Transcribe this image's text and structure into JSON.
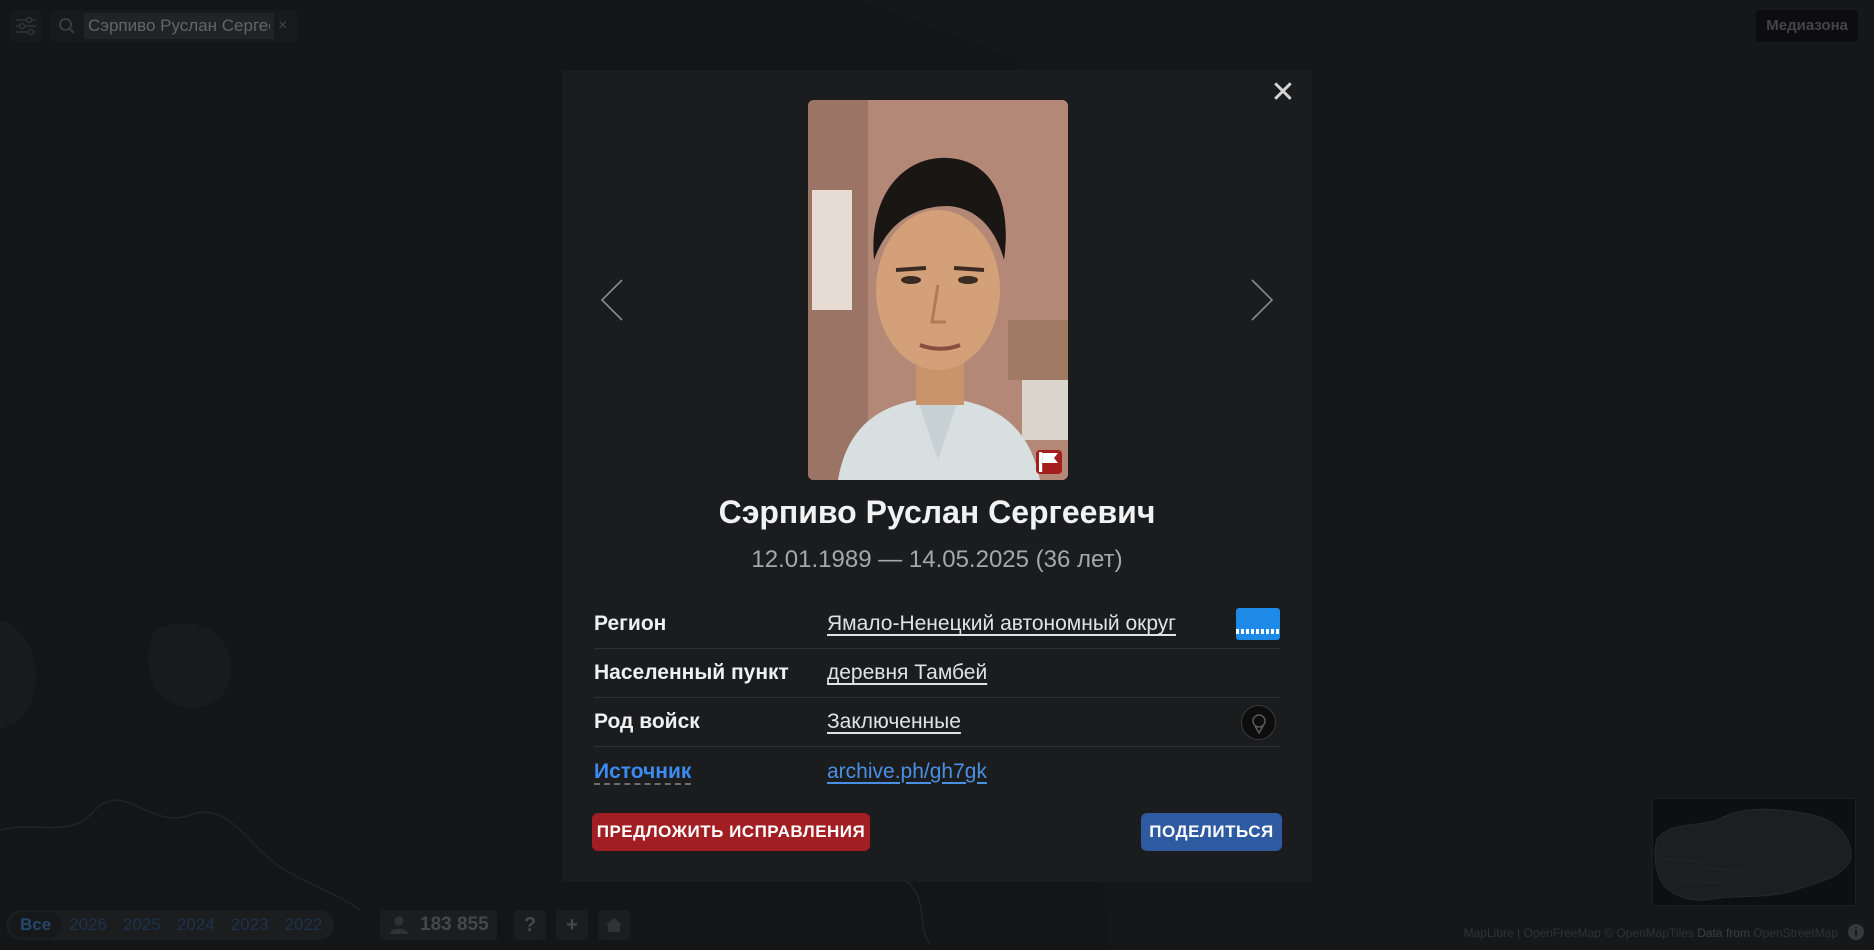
{
  "search": {
    "value": "Сэрпиво Руслан Сергее",
    "clear_symbol": "×"
  },
  "header": {
    "brand_label": "Медиазона"
  },
  "timeline": {
    "years": [
      "Все",
      "2026",
      "2025",
      "2024",
      "2023",
      "2022"
    ],
    "active": "Все"
  },
  "stats": {
    "count": "183 855"
  },
  "toolbar": {
    "help_label": "?",
    "add_label": "+"
  },
  "attribution": {
    "maplibre": "MapLibre",
    "sep1": " | ",
    "openfreemap": "OpenFreeMap",
    "omt": " © OpenMapTiles",
    "data_from": " Data from ",
    "osm": "OpenStreetMap"
  },
  "info_icon": "i",
  "modal": {
    "close_symbol": "✕",
    "name": "Сэрпиво Руслан Сергеевич",
    "dates": "12.01.1989 — 14.05.2025 (36 лет)",
    "rows": [
      {
        "label": "Регион",
        "value": "Ямало-Ненецкий автономный округ"
      },
      {
        "label": "Населенный пункт",
        "value": "деревня Тамбей"
      },
      {
        "label": "Род войск",
        "value": "Заключенные"
      },
      {
        "label": "Источник",
        "value": "archive.ph/gh7gk"
      }
    ],
    "suggest_label": "ПРЕДЛОЖИТЬ ИСПРАВЛЕНИЯ",
    "share_label": "ПОДЕЛИТЬСЯ"
  },
  "colors": {
    "accent_red": "#a11f22",
    "accent_blue": "#2e5aa1",
    "link_blue": "#4a90e2",
    "region_flag": "#1e8ae8"
  },
  "icons": [
    "filter-icon",
    "search-icon",
    "clear-icon",
    "close-icon",
    "chevron-left-icon",
    "chevron-right-icon",
    "flag-icon",
    "region-flag-icon",
    "troops-emblem-icon",
    "people-icon",
    "home-icon",
    "info-icon"
  ]
}
